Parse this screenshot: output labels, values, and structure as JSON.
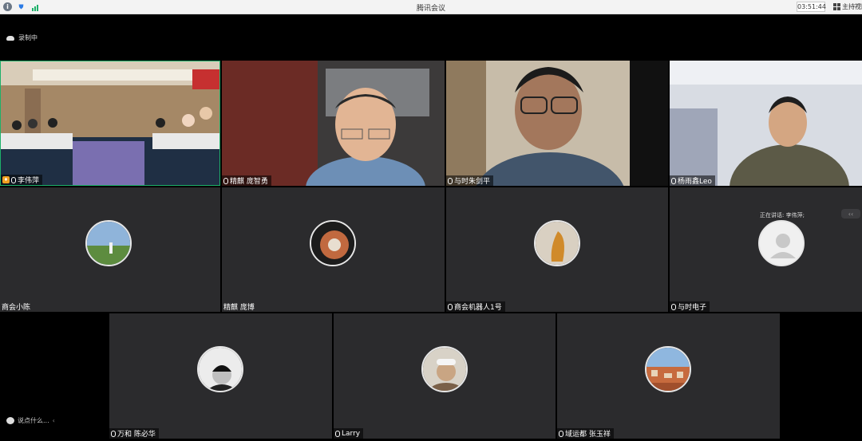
{
  "window": {
    "title": "腾讯会议",
    "time": "03:51:44",
    "speaker_view_label": "主持视图",
    "minimize": "—"
  },
  "recording": {
    "label": "录制中"
  },
  "colors": {
    "tile_bg": "#2b2b2d",
    "title_bar": "#f3f3f3",
    "active_border": "#1db16a"
  },
  "tiles": [
    {
      "name": "李伟萍",
      "kind": "video",
      "host": true
    },
    {
      "name": "精麒 庞智勇",
      "kind": "video"
    },
    {
      "name": "与时朱剑平",
      "kind": "video"
    },
    {
      "name": "杨雨鑫Leo",
      "kind": "video"
    },
    {
      "name": "商会小陈",
      "kind": "avatar"
    },
    {
      "name": "精麒 庞博",
      "kind": "avatar"
    },
    {
      "name": "商会机器人1号",
      "kind": "avatar"
    },
    {
      "name": "与时电子",
      "kind": "avatar"
    },
    {
      "name": "万和 陈必华",
      "kind": "avatar"
    },
    {
      "name": "Larry",
      "kind": "avatar"
    },
    {
      "name": "域运都 张玉祥",
      "kind": "avatar"
    }
  ],
  "now_talking": "正在讲话: 李伟萍;",
  "chat": {
    "placeholder": "说点什么...",
    "toggle": "‹"
  },
  "icons": [
    "info-icon",
    "shield-icon",
    "signal-icon",
    "grid-icon",
    "cloud-recording-icon",
    "mic-icon",
    "host-icon",
    "chat-icon"
  ]
}
